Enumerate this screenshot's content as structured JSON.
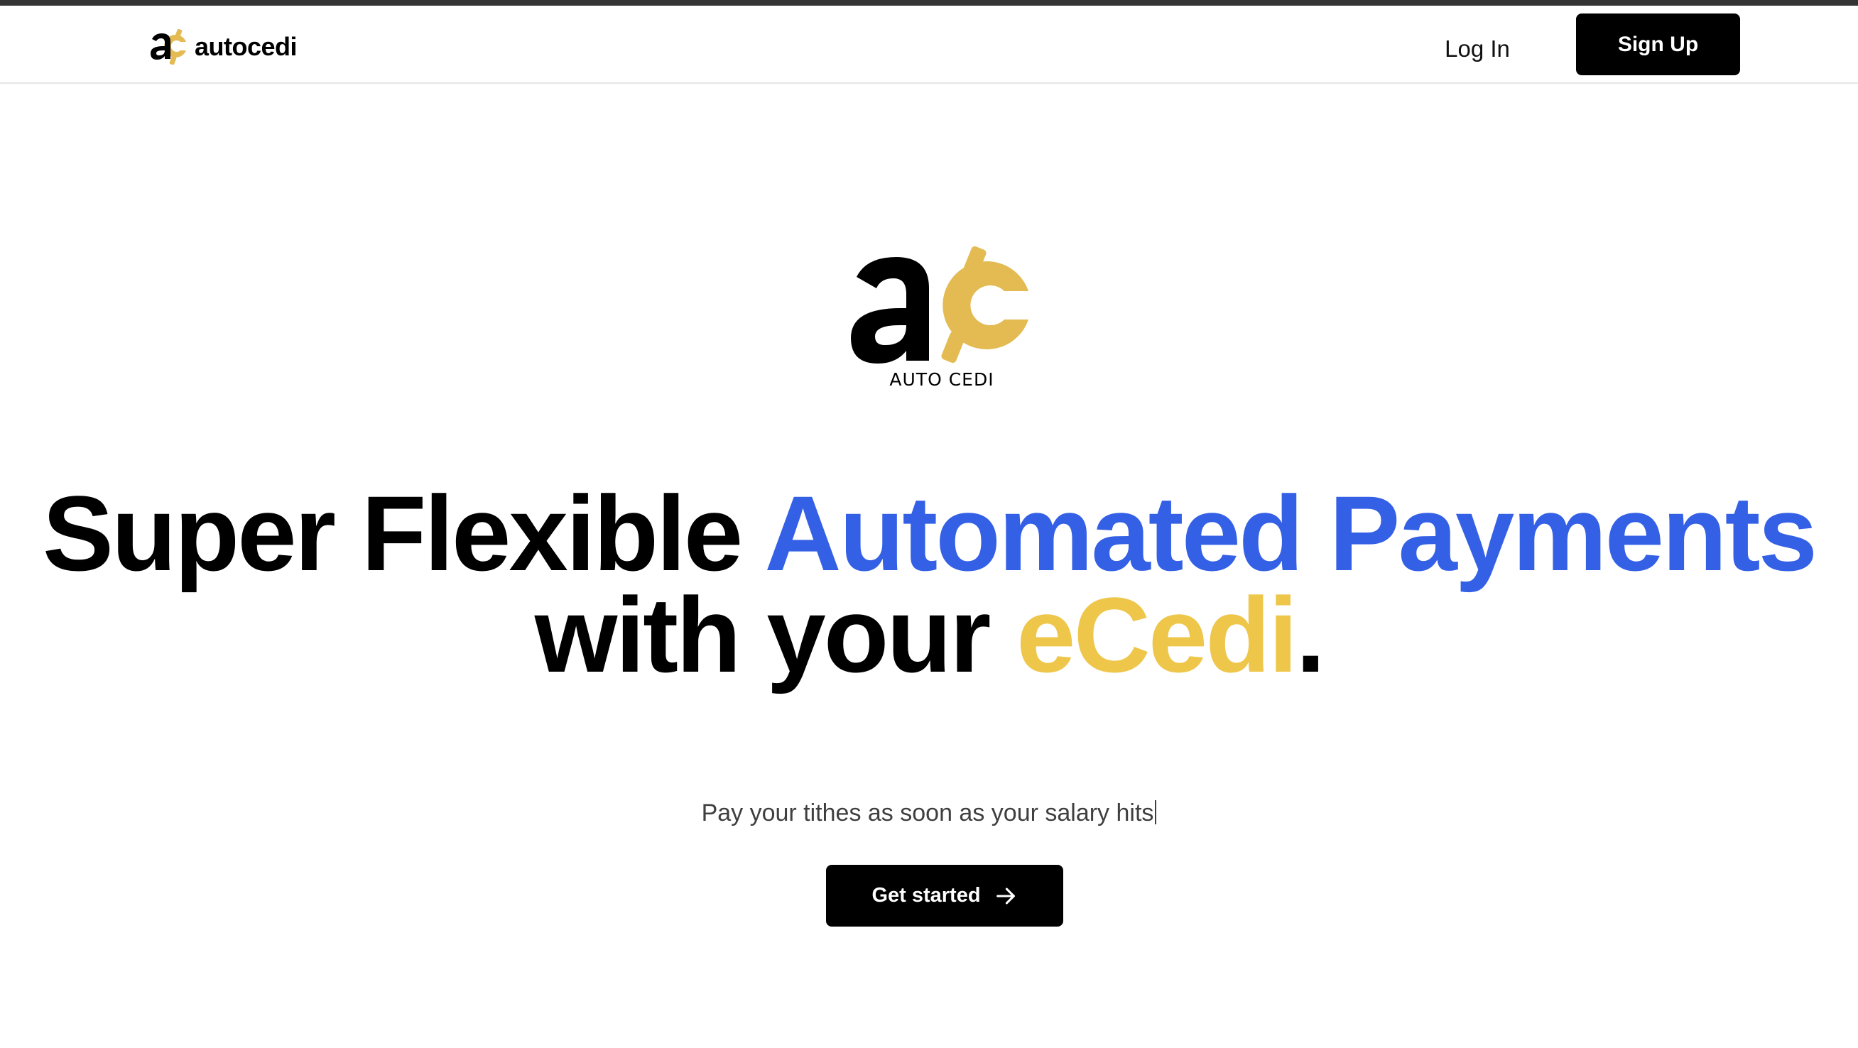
{
  "nav": {
    "brand_name": "autocedi",
    "login_label": "Log In",
    "signup_label": "Sign Up"
  },
  "hero": {
    "logo_caption": "AUTO CEDI",
    "headline": {
      "part1": "Super Flexible ",
      "part2_highlight": "Automated Payments",
      "part3": " with your ",
      "part4_highlight": "eCedi",
      "part5": "."
    },
    "subtitle": "Pay your tithes as soon as your salary hits",
    "cta_label": "Get started"
  },
  "icons": {
    "brand_logo": "ac-logo-icon",
    "cta_arrow": "arrow-right-icon"
  },
  "colors": {
    "accent_blue": "#3460e6",
    "accent_gold": "#eec64a",
    "primary_button": "#000000",
    "top_strip": "#343434"
  }
}
